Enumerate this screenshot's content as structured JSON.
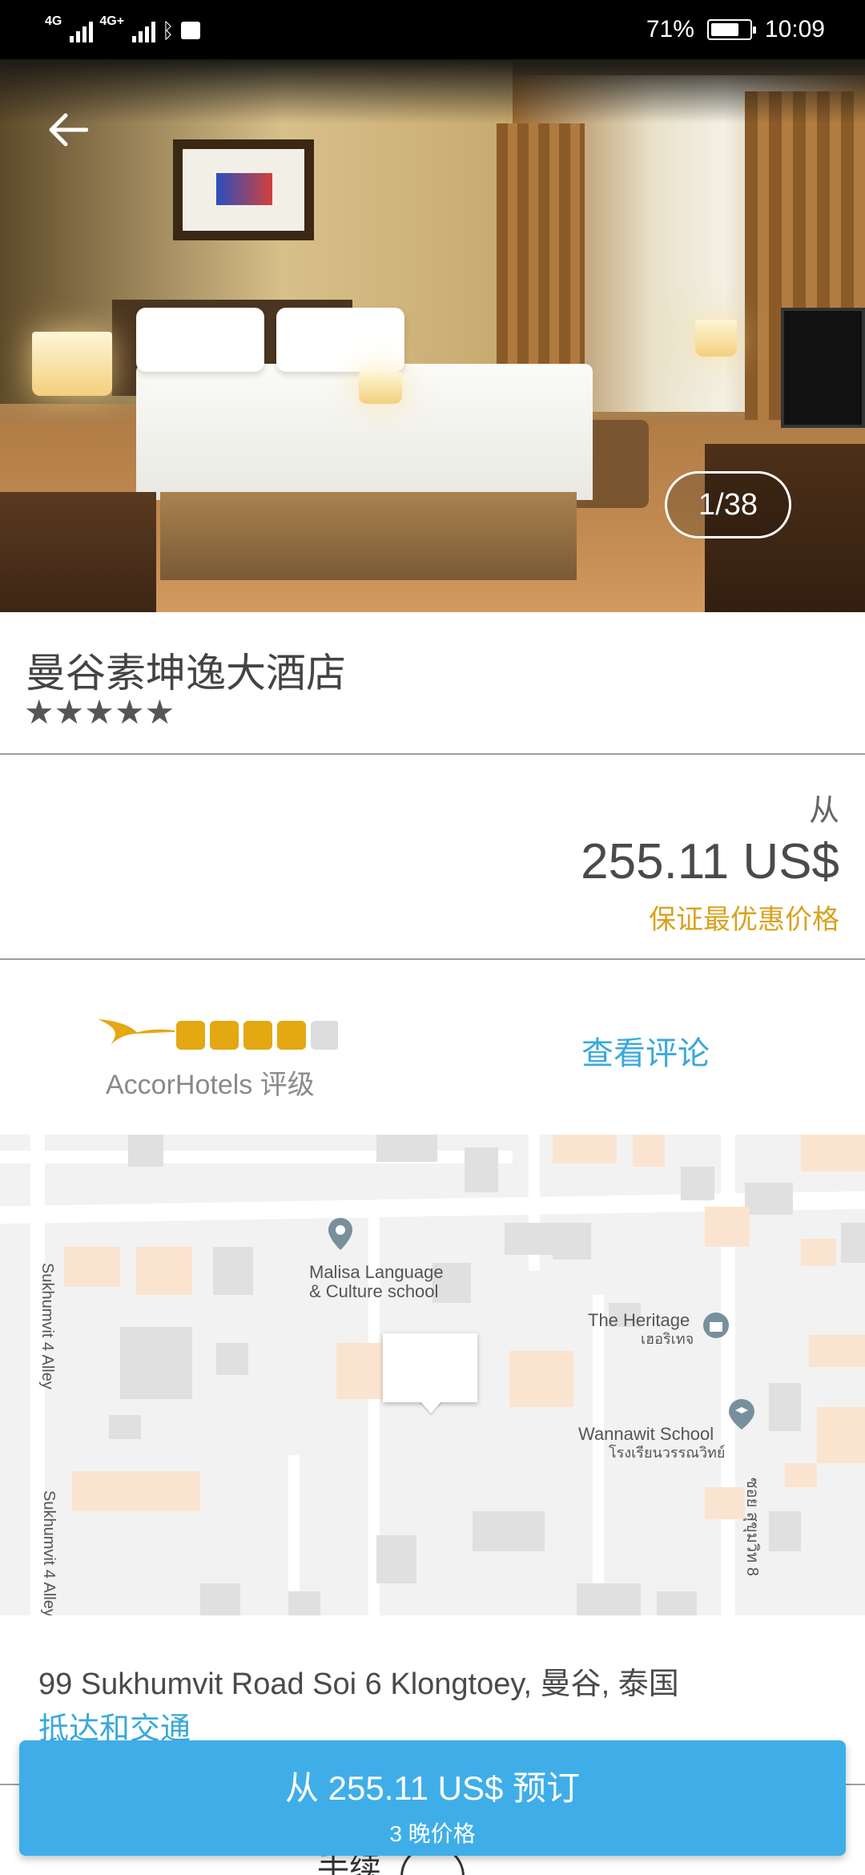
{
  "status_bar": {
    "left_signal_1": "4G",
    "left_signal_2": "4G+",
    "battery_percent_text": "71%",
    "battery_level": 0.71,
    "time": "10:09"
  },
  "gallery": {
    "counter": "1/38"
  },
  "hotel": {
    "name": "曼谷素坤逸大酒店",
    "stars": "★★★★★",
    "star_count": 5
  },
  "price": {
    "from_label": "从",
    "value": "255.11 US$",
    "guarantee": "保证最优惠价格"
  },
  "rating": {
    "label": "AccorHotels 评级",
    "score": 4,
    "max": 5,
    "colors": {
      "filled": "#e3a812",
      "empty": "#dcdcdc"
    },
    "reviews_link": "查看评论"
  },
  "map": {
    "labels": {
      "malisa": "Malisa Language\n& Culture school",
      "heritage": "The Heritage",
      "heritage_thai": "เฮอริเทจ",
      "wannawit": "Wannawit School",
      "wannawit_thai": "โรงเรียนวรรณวิทย์",
      "alley_top": "Sukhumvit 4 Alley",
      "alley_bottom": "Sukhumvit 4 Alley",
      "soi8": "ซอย สุขุมวิท 8"
    }
  },
  "address": {
    "text": "99 Sukhumvit Road Soi 6 Klongtoey, 曼谷, 泰国",
    "directions_link": "抵达和交通"
  },
  "below_fold": {
    "peek_text": "手续"
  },
  "book_button": {
    "main": "从 255.11 US$ 预订",
    "sub": "3 晚价格"
  },
  "colors": {
    "accent_blue": "#39a9dc",
    "button_blue": "#3faee8",
    "gold": "#d9a21e"
  }
}
